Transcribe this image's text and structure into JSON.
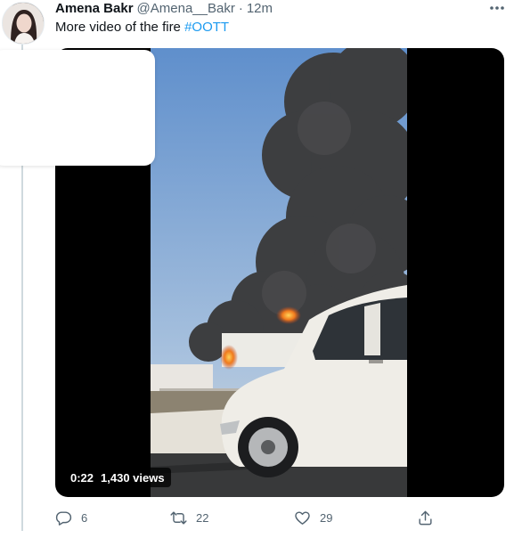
{
  "tweet": {
    "author_name": "Amena Bakr",
    "handle": "@Amena__Bakr",
    "separator": "·",
    "time": "12m",
    "text": "More video of the fire",
    "hashtag": "#OOTT",
    "media": {
      "elapsed": "0:22",
      "views": "1,430 views"
    },
    "actions": {
      "replies": "6",
      "retweets": "22",
      "likes": "29"
    }
  },
  "icons": {
    "more": "more-options-icon",
    "reply": "reply-icon",
    "retweet": "retweet-icon",
    "like": "heart-icon",
    "share": "share-icon"
  },
  "colors": {
    "link": "#1d9bf0",
    "secondary_text": "#536471",
    "primary_text": "#0f1419"
  }
}
